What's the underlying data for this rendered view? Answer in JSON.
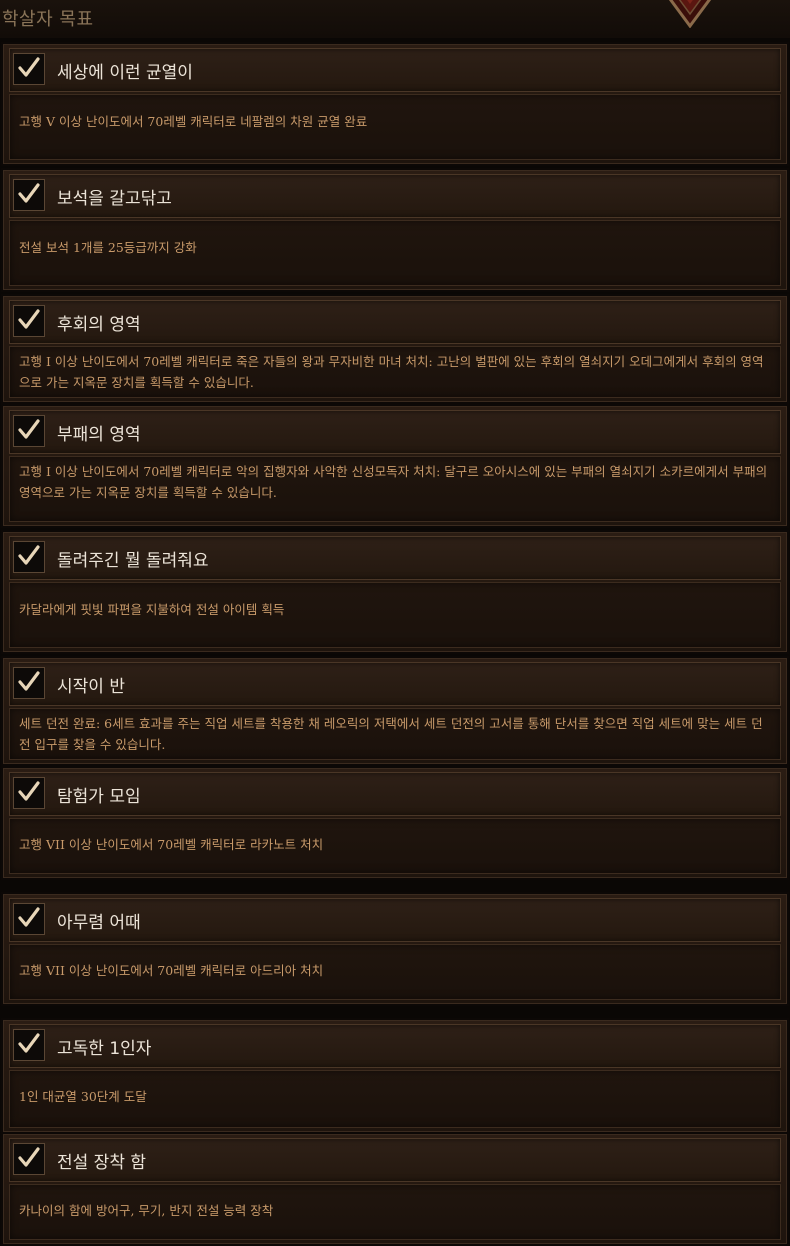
{
  "header": {
    "title": "학살자 목표"
  },
  "colors": {
    "title_text": "#ece4d8",
    "description_text": "#c89a6a",
    "header_text": "#8a7458",
    "checkmark": "#e8d6b8"
  },
  "achievements": [
    {
      "title": "세상에 이런 균열이",
      "description": "고행 V 이상 난이도에서 70레벨 캐릭터로 네팔렘의 차원 균열 완료",
      "completed": true
    },
    {
      "title": "보석을 갈고닦고",
      "description": "전설 보석 1개를 25등급까지 강화",
      "completed": true
    },
    {
      "title": "후회의 영역",
      "description": "고행 I 이상 난이도에서 70레벨 캐릭터로 죽은 자들의 왕과 무자비한 마녀 처치: 고난의 벌판에 있는 후회의 열쇠지기 오데그에게서 후회의 영역으로 가는 지옥문 장치를 획득할 수 있습니다.",
      "completed": true
    },
    {
      "title": "부패의 영역",
      "description": "고행 I 이상 난이도에서 70레벨 캐릭터로 악의 집행자와 사악한 신성모독자 처치: 달구르 오아시스에 있는 부패의 열쇠지기 소카르에게서 부패의 영역으로 가는 지옥문 장치를 획득할 수 있습니다.",
      "completed": true
    },
    {
      "title": "돌려주긴 뭘 돌려줘요",
      "description": "카달라에게 핏빛 파편을 지불하여 전설 아이템 획득",
      "completed": true
    },
    {
      "title": "시작이 반",
      "description": "세트 던전 완료: 6세트 효과를 주는 직업 세트를 착용한 채 레오릭의 저택에서 세트 던전의 고서를 통해 단서를 찾으면 직업 세트에 맞는 세트 던전 입구를 찾을 수 있습니다.",
      "completed": true
    },
    {
      "title": "탐험가 모임",
      "description": "고행 VII 이상 난이도에서 70레벨 캐릭터로 라카노트 처치",
      "completed": true
    },
    {
      "title": "아무렴 어때",
      "description": "고행 VII 이상 난이도에서 70레벨 캐릭터로 아드리아 처치",
      "completed": true
    },
    {
      "title": "고독한 1인자",
      "description": "1인 대균열 30단계 도달",
      "completed": true
    },
    {
      "title": "전설 장착 함",
      "description": "카나이의 함에 방어구, 무기, 반지 전설 능력 장착",
      "completed": true
    }
  ]
}
